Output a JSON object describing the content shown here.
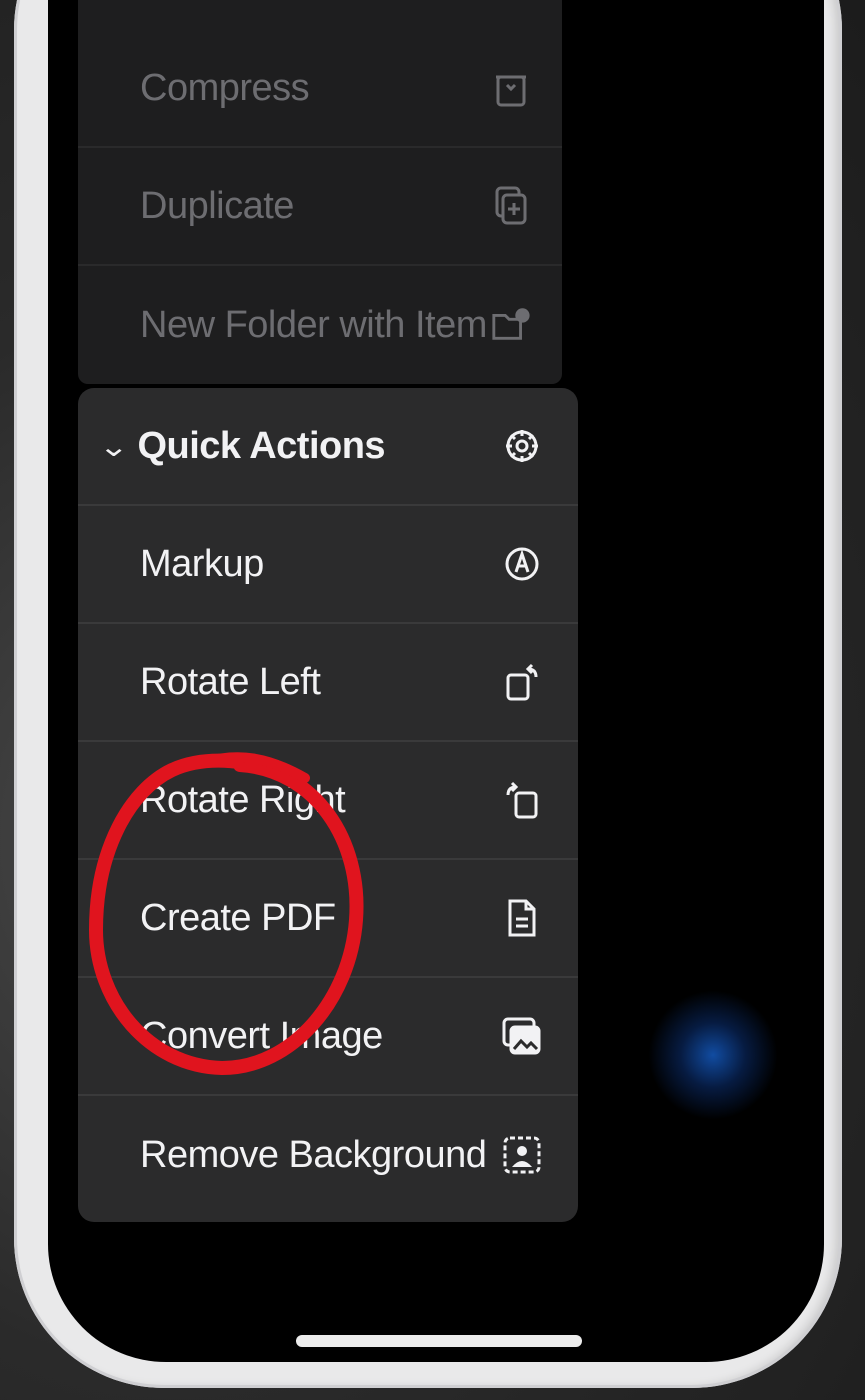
{
  "menu_upper": {
    "items": [
      {
        "label": "Compress",
        "icon": "archive-box-icon"
      },
      {
        "label": "Duplicate",
        "icon": "duplicate-icon"
      },
      {
        "label": "New Folder with Item",
        "icon": "folder-badge-icon"
      }
    ]
  },
  "quick_actions": {
    "header_label": "Quick Actions",
    "header_icon": "gear-icon",
    "items": [
      {
        "label": "Markup",
        "icon": "markup-pen-icon"
      },
      {
        "label": "Rotate Left",
        "icon": "rotate-left-icon"
      },
      {
        "label": "Rotate Right",
        "icon": "rotate-right-icon"
      },
      {
        "label": "Create PDF",
        "icon": "document-icon"
      },
      {
        "label": "Convert Image",
        "icon": "convert-image-icon"
      },
      {
        "label": "Remove Background",
        "icon": "remove-background-icon"
      }
    ]
  },
  "colors": {
    "panel_bg": "#2b2b2c",
    "upper_bg": "#1e1e1f",
    "text_primary": "#f2f2f4",
    "text_dimmed": "#6d6d71",
    "annotation_red": "#e0141e",
    "glow_blue": "#1250aa"
  }
}
